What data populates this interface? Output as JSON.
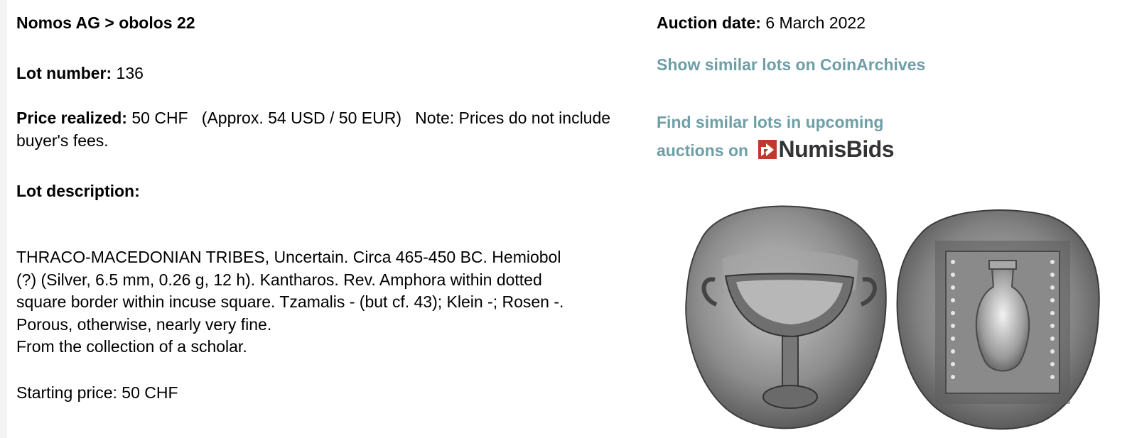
{
  "title": "Nomos AG > obolos 22",
  "lot_number": {
    "label": "Lot number:",
    "value": "136"
  },
  "price_realized": {
    "label": "Price realized:",
    "value": "50 CHF",
    "approx": "(Approx. 54 USD / 50 EUR)",
    "note": "Note: Prices do not include buyer's fees."
  },
  "lot_description_label": "Lot description:",
  "description_lines": [
    "THRACO-MACEDONIAN TRIBES, Uncertain. Circa 465-450 BC. Hemiobol",
    "(?) (Silver, 6.5 mm, 0.26 g, 12 h). Kantharos. Rev. Amphora within dotted",
    "square border within incuse square. Tzamalis - (but cf. 43); Klein -; Rosen -.",
    "Porous, otherwise, nearly very fine.",
    "From the collection of a scholar."
  ],
  "starting_price": "Starting price: 50 CHF",
  "auction_date": {
    "label": "Auction date:",
    "value": "6 March 2022"
  },
  "links": {
    "coinarchives": "Show similar lots on CoinArchives",
    "numisbids_line1": "Find similar lots in upcoming",
    "numisbids_line2": "auctions on"
  },
  "numisbids_logo": {
    "part1": "Numis",
    "part2": "Bids"
  },
  "colors": {
    "link": "#6e9ea7",
    "logo_red": "#c0392b",
    "logo_text": "#333333"
  },
  "icons": [
    "numisbids-logo-icon",
    "coin-obverse-image",
    "coin-reverse-image"
  ]
}
